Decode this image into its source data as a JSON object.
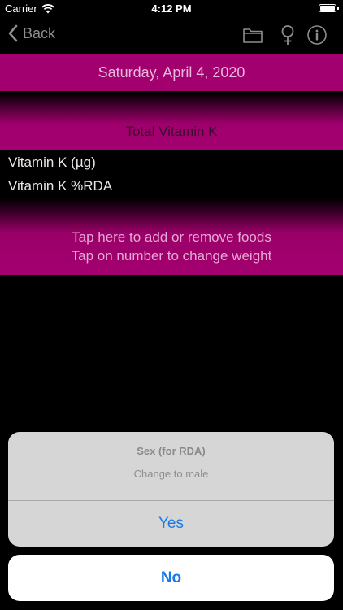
{
  "status": {
    "carrier": "Carrier",
    "time": "4:12 PM"
  },
  "nav": {
    "back_label": "Back"
  },
  "date_label": "Saturday, April 4, 2020",
  "total_label": "Total Vitamin K",
  "rows": [
    {
      "label": "Vitamin K (µg)"
    },
    {
      "label": "Vitamin K %RDA"
    }
  ],
  "food_hint": {
    "line1": "Tap here to add or remove foods",
    "line2": "Tap on number to change weight"
  },
  "sheet": {
    "title": "Sex (for RDA)",
    "message": "Change to male",
    "yes_label": "Yes",
    "no_label": "No"
  },
  "colors": {
    "accent_magenta": "#a3006f",
    "ios_blue": "#1a7ae6"
  },
  "icons": {
    "nav": [
      "folder-icon",
      "female-sex-icon",
      "info-icon"
    ]
  }
}
